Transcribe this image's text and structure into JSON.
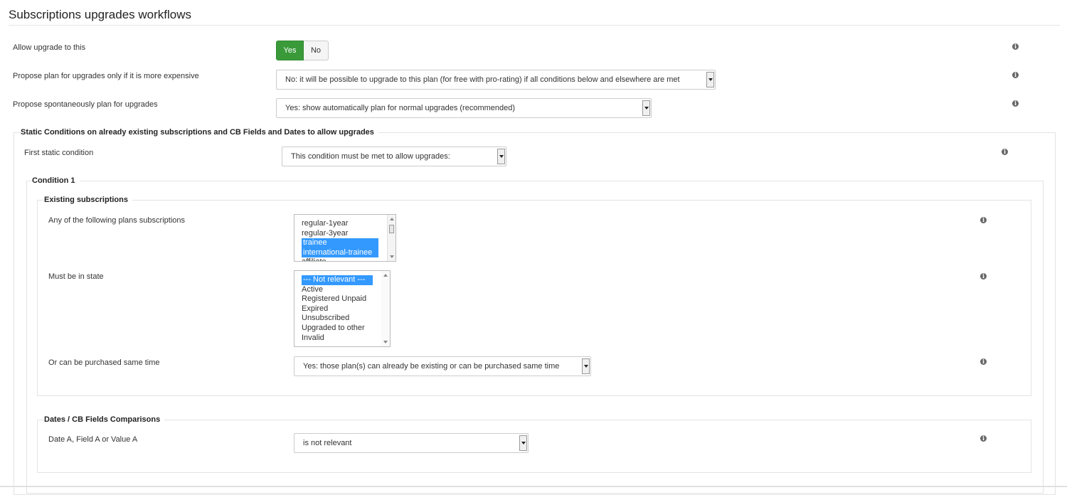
{
  "page": {
    "title": "Subscriptions upgrades workflows"
  },
  "rows": {
    "allow_upgrade": {
      "label": "Allow upgrade to this",
      "yes": "Yes",
      "no": "No",
      "selected": "Yes"
    },
    "propose_expensive": {
      "label": "Propose plan for upgrades only if it is more expensive",
      "value": "No: it will be possible to upgrade to this plan (for free with pro-rating) if all conditions below and elsewhere are met"
    },
    "propose_spontaneous": {
      "label": "Propose spontaneously plan for upgrades",
      "value": "Yes: show automatically plan for normal upgrades (recommended)"
    }
  },
  "static_conditions": {
    "legend": "Static Conditions on already existing subscriptions and CB Fields and Dates to allow upgrades",
    "first": {
      "label": "First static condition",
      "value": "This condition must be met to allow upgrades:"
    },
    "condition1": {
      "legend": "Condition 1",
      "existing": {
        "legend": "Existing subscriptions",
        "plans": {
          "label": "Any of the following plans subscriptions",
          "options": [
            {
              "text": "regular-1year",
              "selected": false
            },
            {
              "text": "regular-3year",
              "selected": false
            },
            {
              "text": "trainee",
              "selected": true
            },
            {
              "text": "international-trainee",
              "selected": true
            },
            {
              "text": "affiliate",
              "selected": false
            }
          ]
        },
        "state": {
          "label": "Must be in state",
          "options": [
            {
              "text": "--- Not relevant ---",
              "selected": true
            },
            {
              "text": "Active",
              "selected": false
            },
            {
              "text": "Registered Unpaid",
              "selected": false
            },
            {
              "text": "Expired",
              "selected": false
            },
            {
              "text": "Unsubscribed",
              "selected": false
            },
            {
              "text": "Upgraded to other",
              "selected": false
            },
            {
              "text": "Invalid",
              "selected": false
            }
          ]
        },
        "purchase": {
          "label": "Or can be purchased same time",
          "value": "Yes: those plan(s) can already be existing or can be purchased same time"
        }
      },
      "dates": {
        "legend": "Dates / CB Fields Comparisons",
        "date_a": {
          "label": "Date A, Field A or Value A",
          "value": "is not relevant"
        }
      }
    }
  },
  "icons": {
    "info": "i"
  },
  "colors": {
    "yes_active": "#3a9a3a",
    "selection": "#3399ff"
  }
}
